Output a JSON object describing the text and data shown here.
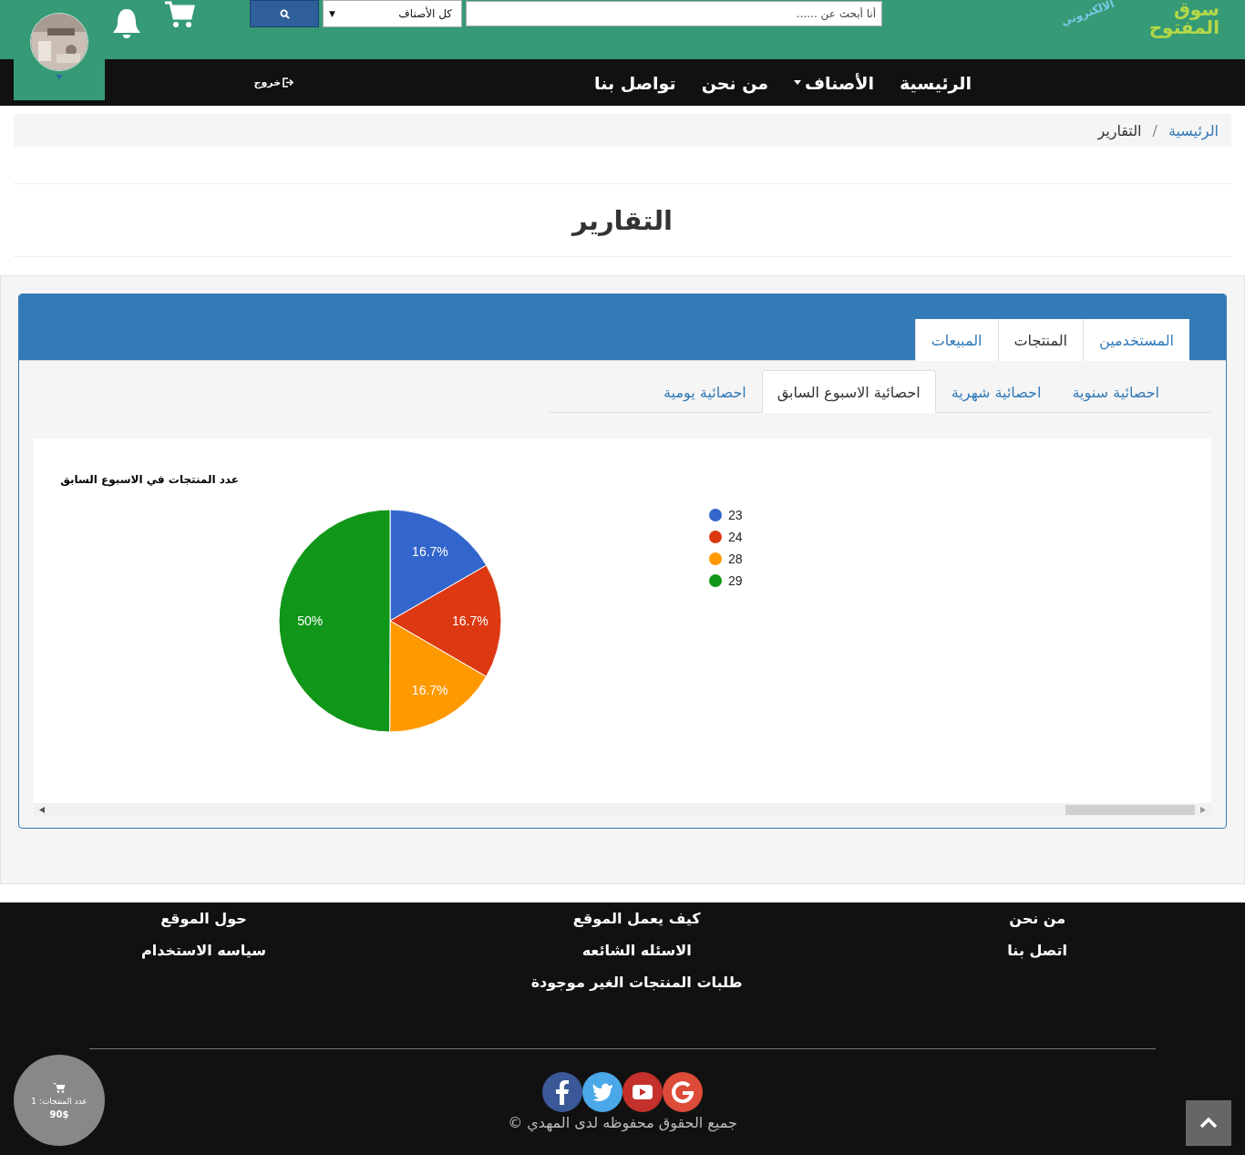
{
  "header": {
    "logo": [
      "سوق",
      "المفتوح",
      "الالكتروني"
    ],
    "search": {
      "placeholder": "أنا أبحث عن ......"
    },
    "category_select": {
      "value": "كل الأصناف",
      "arrow": "▼"
    }
  },
  "nav": {
    "items": [
      {
        "label": "الرئيسية",
        "dropdown": false
      },
      {
        "label": "الأصناف",
        "dropdown": true
      },
      {
        "label": "من نحن",
        "dropdown": false
      },
      {
        "label": "تواصل بنا",
        "dropdown": false
      }
    ],
    "logout": "خروج"
  },
  "breadcrumb": {
    "separator": "/",
    "items": [
      {
        "label": "الرئيسية",
        "selected": false
      },
      {
        "label": "التقارير",
        "selected": true
      }
    ]
  },
  "page_title": "التقارير",
  "main_tabs": [
    {
      "label": "المستخدمين",
      "selected": false
    },
    {
      "label": "المنتجات",
      "selected": true
    },
    {
      "label": "المبيعات",
      "selected": false
    }
  ],
  "sub_tabs": [
    {
      "label": "احصائية سنوية",
      "selected": false
    },
    {
      "label": "احصائية شهرية",
      "selected": false
    },
    {
      "label": "احصائية الاسبوع السابق",
      "selected": true
    },
    {
      "label": "احصائية يومية",
      "selected": false
    }
  ],
  "chart": {
    "chart_data": {
      "type": "pie",
      "title": "عدد المنتجات في الاسبوع السابق",
      "categories": [
        "23",
        "24",
        "28",
        "29"
      ],
      "colors": [
        "#3366cc",
        "#dc3912",
        "#ff9900",
        "#109618"
      ],
      "values": [
        16.7,
        16.7,
        16.7,
        50
      ],
      "value_labels": [
        "16.7%",
        "16.7%",
        "16.7%",
        "50%"
      ],
      "data_labels": true,
      "legend": "right"
    }
  },
  "footer": {
    "columns": [
      [
        "من نحن",
        "اتصل بنا"
      ],
      [
        "كيف يعمل الموقع",
        "الاسئله الشائعه",
        "طلبات المنتجات الغير موجودة"
      ],
      [
        "حول الموقع",
        "سياسه الاستخدام"
      ]
    ],
    "copyright": "جميع الحقوق محفوظه لدى المهدي ©"
  },
  "cart_badge": {
    "count_label": "عدد المنتجات: 1",
    "total": "90$"
  }
}
